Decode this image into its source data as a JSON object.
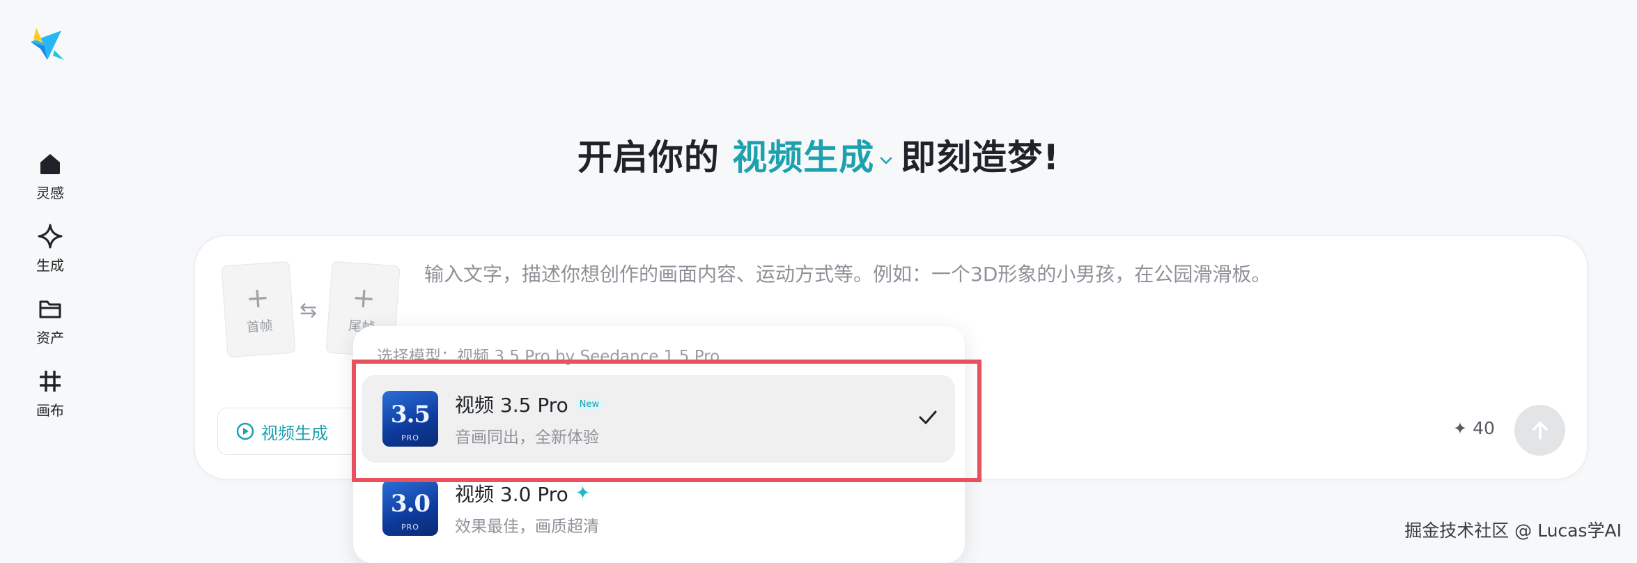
{
  "sidebar": {
    "items": [
      {
        "label": "灵感",
        "icon": "home-icon"
      },
      {
        "label": "生成",
        "icon": "sparkle-icon"
      },
      {
        "label": "资产",
        "icon": "folder-icon"
      },
      {
        "label": "画布",
        "icon": "canvas-grid-icon"
      }
    ]
  },
  "headline": {
    "prefix": "开启你的",
    "mode": "视频生成",
    "suffix": "即刻造梦!"
  },
  "composer": {
    "first_frame_label": "首帧",
    "last_frame_label": "尾帧",
    "prompt_placeholder": "输入文字，描述你想创作的画面内容、运动方式等。例如：一个3D形象的小男孩，在公园滑滑板。",
    "mode_pill_label": "视频生成",
    "credits": "40"
  },
  "model_dropdown": {
    "header": "选择模型：视频 3.5 Pro by Seedance 1.5 Pro",
    "items": [
      {
        "thumb_number": "3.5",
        "thumb_sub": "PRO",
        "name": "视频 3.5 Pro",
        "badge": "New",
        "description": "音画同出，全新体验",
        "selected": true
      },
      {
        "thumb_number": "3.0",
        "thumb_sub": "PRO",
        "name": "视频 3.0 Pro",
        "badge": "",
        "description": "效果最佳，画质超清",
        "selected": false
      }
    ]
  },
  "watermark": "掘金技术社区 @ Lucas学AI",
  "colors": {
    "accent": "#1da1ae",
    "highlight_border": "#e8525f",
    "background": "#f7f8fa"
  }
}
